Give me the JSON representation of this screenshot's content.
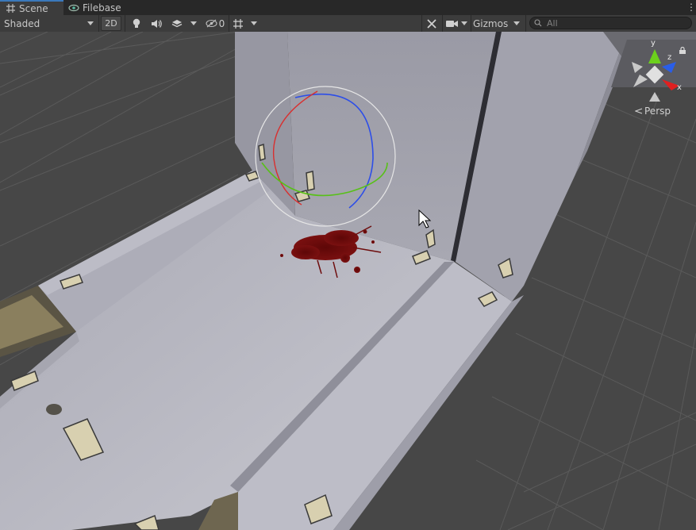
{
  "tabs": [
    {
      "label": "Scene",
      "icon": "grid-icon",
      "active": true
    },
    {
      "label": "Filebase",
      "icon": "eye-icon",
      "active": false
    }
  ],
  "toolbar": {
    "draw_mode": "Shaded",
    "two_d_label": "2D",
    "hidden_count": "0",
    "gizmos_label": "Gizmos",
    "search_placeholder": "All"
  },
  "scene": {
    "camera_mode": "Persp",
    "axes": {
      "y": "y",
      "z": "z",
      "x": "x"
    }
  },
  "colors": {
    "panel_bg": "#3c3c3c",
    "tab_bg": "#282828",
    "accent": "#3a79bb",
    "axis_x": "#e02020",
    "axis_y": "#6cd01c",
    "axis_z": "#2a5ee8",
    "blood": "#6e0d0d"
  }
}
